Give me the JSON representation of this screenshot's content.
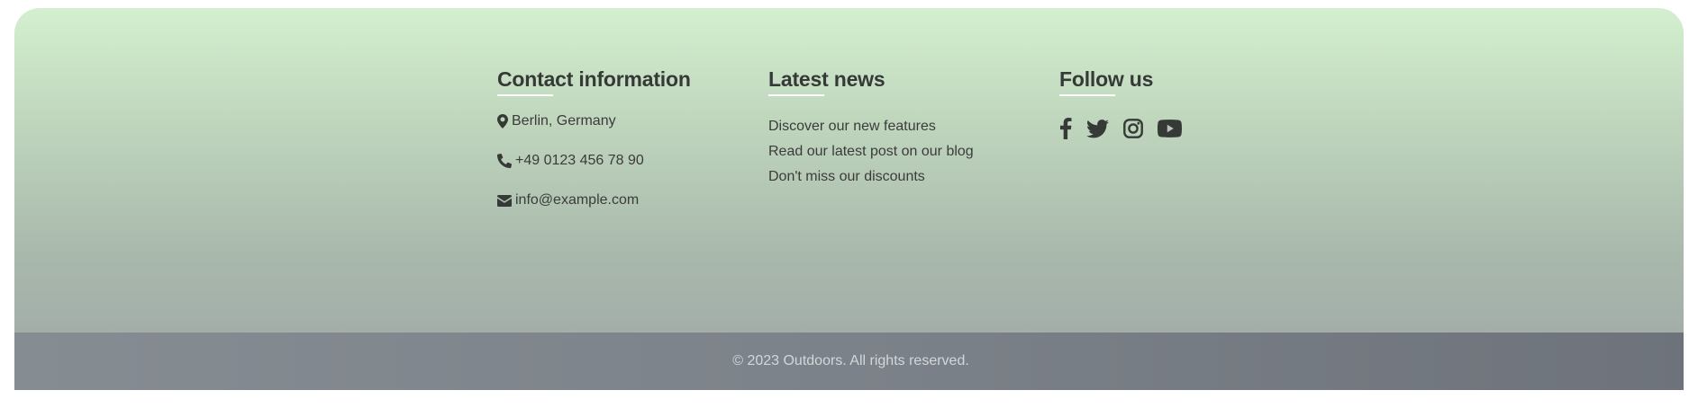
{
  "contact": {
    "title": "Contact information",
    "location": "Berlin, Germany",
    "phone": "+49 0123 456 78 90",
    "email": "info@example.com"
  },
  "news": {
    "title": "Latest news",
    "items": [
      "Discover our new features",
      "Read our latest post on our blog",
      "Don't miss our discounts"
    ]
  },
  "follow": {
    "title": "Follow us",
    "icons": [
      "facebook-icon",
      "twitter-icon",
      "instagram-icon",
      "youtube-icon"
    ]
  },
  "footer": {
    "copyright": "© 2023 Outdoors. All rights reserved."
  },
  "colors": {
    "gradient_top": "#d4efcf",
    "gradient_bottom": "#9ea6a6",
    "bar": "#7c8289",
    "text": "#3b3b3b",
    "underline": "#ffffff"
  }
}
